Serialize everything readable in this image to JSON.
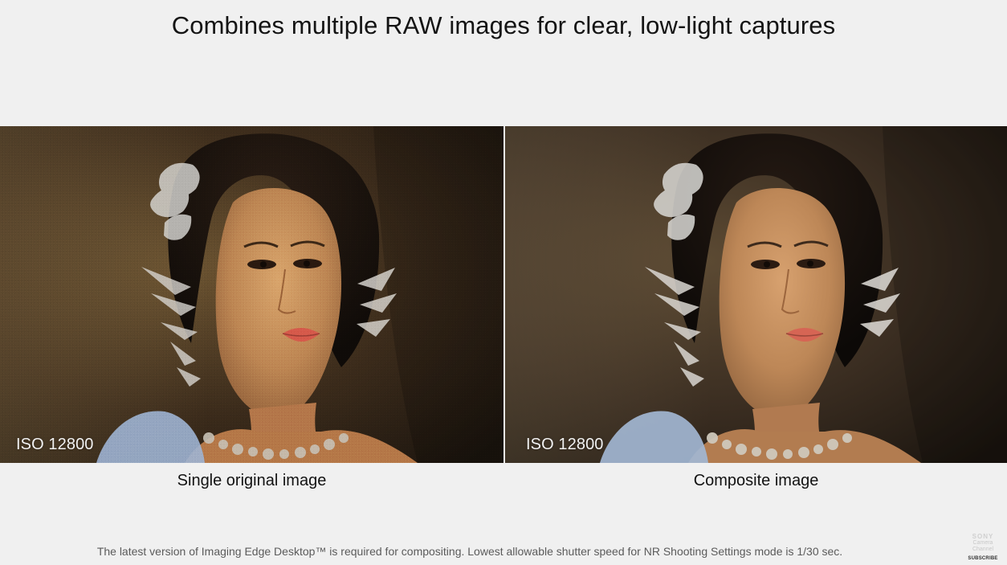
{
  "header": {
    "title": "Combines multiple RAW images for clear, low-light captures"
  },
  "comparison": {
    "left": {
      "iso_label": "ISO 12800",
      "caption": "Single original image"
    },
    "right": {
      "iso_label": "ISO 12800",
      "caption": "Composite image"
    }
  },
  "footer": {
    "note": "The latest version of Imaging Edge Desktop™ is required for compositing. Lowest allowable shutter speed for NR Shooting Settings mode is 1/30 sec."
  },
  "watermark": {
    "brand": "SONY",
    "line1": "Camera",
    "line2": "Channel",
    "subscribe": "SUBSCRIBE"
  },
  "colors": {
    "page_background": "#f0f0f0",
    "photo_warm_shadow": "#1a130d",
    "skin_tone": "#c58b5b",
    "hair": "#16100c"
  }
}
